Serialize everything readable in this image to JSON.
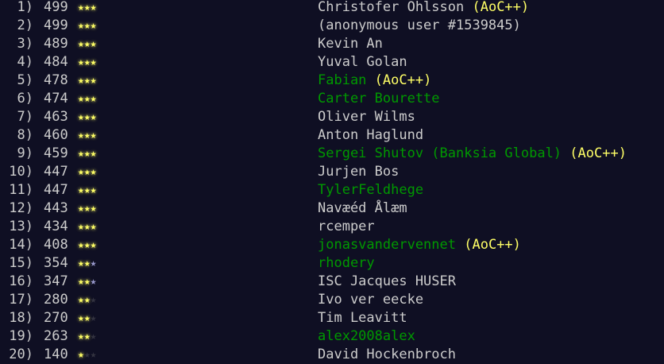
{
  "colors": {
    "background": "#0f0f23",
    "text": "#cccccc",
    "link": "#009900",
    "gold_star": "#ffff66",
    "silver_star": "#9999cc",
    "empty_star": "#333340",
    "supporter": "#ffff66"
  },
  "leaderboard": [
    {
      "rank": "1)",
      "score": "499",
      "stars": [
        "gold",
        "gold",
        "gold"
      ],
      "name": "Christofer Ohlsson",
      "linked": false,
      "supporter": "(AoC++)"
    },
    {
      "rank": "2)",
      "score": "499",
      "stars": [
        "gold",
        "gold",
        "gold"
      ],
      "name": "(anonymous user #1539845)",
      "linked": false,
      "supporter": ""
    },
    {
      "rank": "3)",
      "score": "489",
      "stars": [
        "gold",
        "gold",
        "gold"
      ],
      "name": "Kevin An",
      "linked": false,
      "supporter": ""
    },
    {
      "rank": "4)",
      "score": "484",
      "stars": [
        "gold",
        "gold",
        "gold"
      ],
      "name": "Yuval Golan",
      "linked": false,
      "supporter": ""
    },
    {
      "rank": "5)",
      "score": "478",
      "stars": [
        "gold",
        "gold",
        "gold"
      ],
      "name": "Fabian",
      "linked": true,
      "supporter": "(AoC++)"
    },
    {
      "rank": "6)",
      "score": "474",
      "stars": [
        "gold",
        "gold",
        "gold"
      ],
      "name": "Carter Bourette",
      "linked": true,
      "supporter": ""
    },
    {
      "rank": "7)",
      "score": "463",
      "stars": [
        "gold",
        "gold",
        "gold"
      ],
      "name": "Oliver Wilms",
      "linked": false,
      "supporter": ""
    },
    {
      "rank": "8)",
      "score": "460",
      "stars": [
        "gold",
        "gold",
        "gold"
      ],
      "name": "Anton Haglund",
      "linked": false,
      "supporter": ""
    },
    {
      "rank": "9)",
      "score": "459",
      "stars": [
        "gold",
        "gold",
        "gold"
      ],
      "name": "Sergei Shutov (Banksia Global)",
      "linked": true,
      "supporter": "(AoC++)"
    },
    {
      "rank": "10)",
      "score": "447",
      "stars": [
        "gold",
        "gold",
        "gold"
      ],
      "name": "Jurjen Bos",
      "linked": false,
      "supporter": ""
    },
    {
      "rank": "11)",
      "score": "447",
      "stars": [
        "gold",
        "gold",
        "gold"
      ],
      "name": "TylerFeldhege",
      "linked": true,
      "supporter": ""
    },
    {
      "rank": "12)",
      "score": "443",
      "stars": [
        "gold",
        "gold",
        "gold"
      ],
      "name": "Navæéd Ålæm",
      "linked": false,
      "supporter": ""
    },
    {
      "rank": "13)",
      "score": "434",
      "stars": [
        "gold",
        "gold",
        "gold"
      ],
      "name": "rcemper",
      "linked": false,
      "supporter": ""
    },
    {
      "rank": "14)",
      "score": "408",
      "stars": [
        "gold",
        "gold",
        "gold"
      ],
      "name": "jonasvandervennet",
      "linked": true,
      "supporter": "(AoC++)"
    },
    {
      "rank": "15)",
      "score": "354",
      "stars": [
        "gold",
        "gold",
        "silver"
      ],
      "name": "rhodery",
      "linked": true,
      "supporter": ""
    },
    {
      "rank": "16)",
      "score": "347",
      "stars": [
        "gold",
        "gold",
        "silver"
      ],
      "name": "ISC Jacques HUSER",
      "linked": false,
      "supporter": ""
    },
    {
      "rank": "17)",
      "score": "280",
      "stars": [
        "gold",
        "gold",
        "none"
      ],
      "name": "Ivo ver eecke",
      "linked": false,
      "supporter": ""
    },
    {
      "rank": "18)",
      "score": "270",
      "stars": [
        "gold",
        "gold",
        "none"
      ],
      "name": "Tim Leavitt",
      "linked": false,
      "supporter": ""
    },
    {
      "rank": "19)",
      "score": "263",
      "stars": [
        "gold",
        "gold",
        "none"
      ],
      "name": "alex2008alex",
      "linked": true,
      "supporter": ""
    },
    {
      "rank": "20)",
      "score": "140",
      "stars": [
        "gold",
        "none",
        "none"
      ],
      "name": "David Hockenbroch",
      "linked": false,
      "supporter": ""
    }
  ]
}
